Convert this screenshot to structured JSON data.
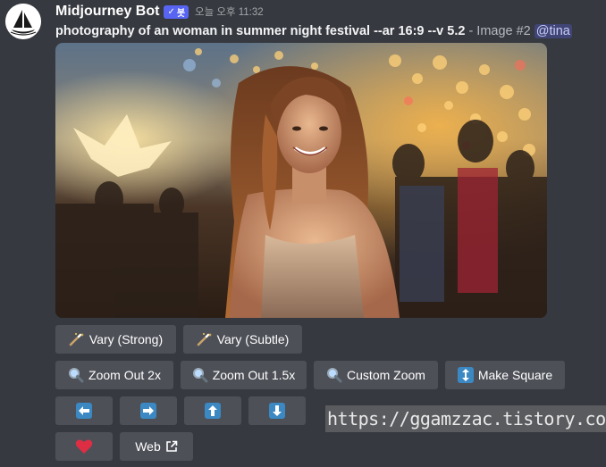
{
  "message": {
    "author": "Midjourney Bot",
    "badge": "봇",
    "timestamp": "오늘 오후 11:32",
    "prompt": "photography of an woman in summer night festival --ar 16:9 --v 5.2",
    "image_label": "- Image #2",
    "mention": "@tina"
  },
  "attachment": {
    "subject": "photo of a smiling woman with long wavy hair at a night festival with bokeh lights"
  },
  "buttons": {
    "row1": [
      {
        "label": "Vary (Strong)",
        "icon": "magic-wand-icon"
      },
      {
        "label": "Vary (Subtle)",
        "icon": "magic-wand-icon"
      }
    ],
    "row2": [
      {
        "label": "Zoom Out 2x",
        "icon": "magnifier-icon"
      },
      {
        "label": "Zoom Out 1.5x",
        "icon": "magnifier-icon"
      },
      {
        "label": "Custom Zoom",
        "icon": "magnifier-icon"
      },
      {
        "label": "Make Square",
        "icon": "up-down-arrow-icon"
      }
    ],
    "row3": [
      {
        "icon": "arrow-left-icon"
      },
      {
        "icon": "arrow-right-icon"
      },
      {
        "icon": "arrow-up-icon"
      },
      {
        "icon": "arrow-down-icon"
      }
    ],
    "row4": [
      {
        "icon": "heart-icon"
      },
      {
        "label": "Web",
        "icon": "external-link-icon"
      }
    ]
  },
  "watermark": "https://ggamzzac.tistory.com",
  "colors": {
    "background": "#36393f",
    "button": "#4e5058",
    "badge": "#5865f2",
    "arrow_button": "#3b88c3",
    "heart": "#dd2e44"
  }
}
